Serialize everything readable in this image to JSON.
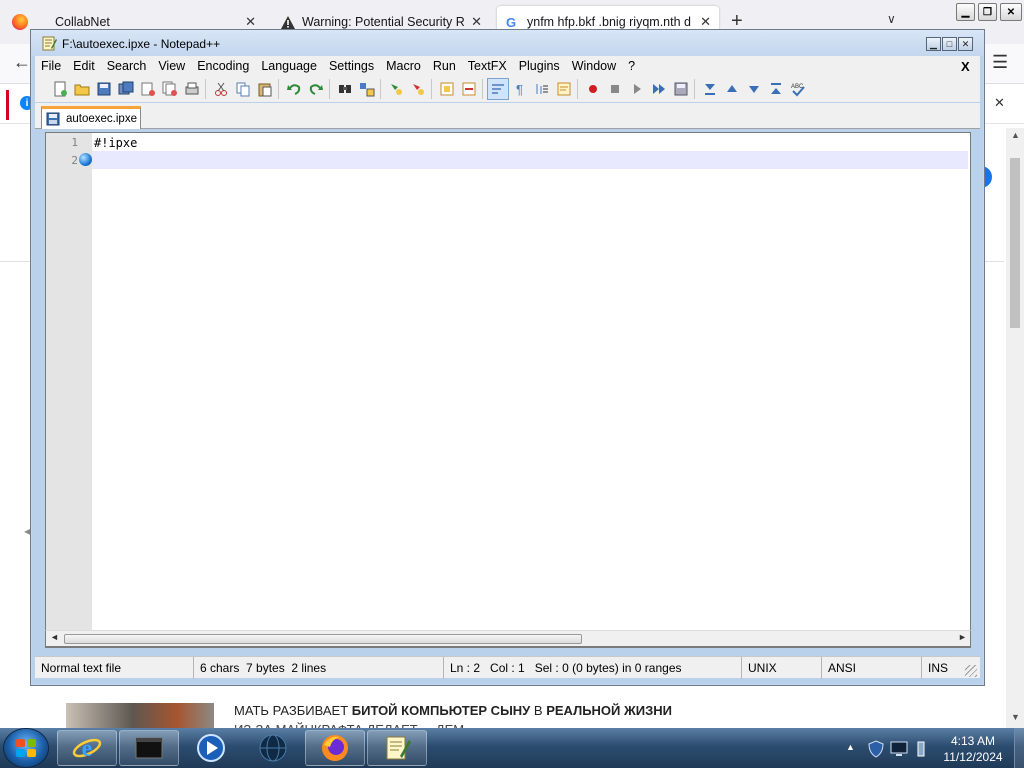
{
  "browser": {
    "tabs": [
      {
        "label": "CollabNet",
        "icon": "firefox-icon"
      },
      {
        "label": "Warning: Potential Security Risk",
        "icon": "warning-icon"
      },
      {
        "label": "ynfm hfp.bkf .bnig riyqm.nth d",
        "icon": "google-icon"
      }
    ],
    "new_tab": "+",
    "list_tabs": "∨",
    "window_controls": [
      "minimize",
      "restore",
      "close"
    ],
    "page": {
      "headline_plain_1": "МАТЬ РАЗБИВАЕТ ",
      "headline_bold_1": "БИТОЙ КОМПЬЮТЕР СЫНУ",
      "headline_plain_2": " В ",
      "headline_bold_2": "РЕАЛЬНОЙ ЖИЗНИ",
      "subline": "ИЗ-ЗА МАЙНКРАФТА ДЕЛАЕТ ... ДЕМ"
    }
  },
  "notepad": {
    "title": "F:\\autoexec.ipxe - Notepad++",
    "menu": [
      "File",
      "Edit",
      "Search",
      "View",
      "Encoding",
      "Language",
      "Settings",
      "Macro",
      "Run",
      "TextFX",
      "Plugins",
      "Window",
      "?"
    ],
    "menu_close": "X",
    "toolbar": [
      "new-file-icon",
      "open-file-icon",
      "save-icon",
      "save-all-icon",
      "close-icon",
      "close-all-icon",
      "print-icon",
      "|",
      "cut-icon",
      "copy-icon",
      "paste-icon",
      "|",
      "undo-icon",
      "redo-icon",
      "|",
      "find-icon",
      "replace-icon",
      "|",
      "zoom-in-icon",
      "zoom-out-icon",
      "|",
      "sync-vertical-icon",
      "sync-horizontal-icon",
      "|",
      "word-wrap-icon",
      "show-all-chars-icon",
      "indent-guide-icon",
      "user-lang-icon",
      "|",
      "record-macro-icon",
      "stop-record-icon",
      "play-macro-icon",
      "run-multiple-icon",
      "save-macro-icon",
      "|",
      "fold-all-icon",
      "prev-bookmark-icon",
      "next-bookmark-icon",
      "unfold-all-icon",
      "spell-check-icon"
    ],
    "file_tab": "autoexec.ipxe",
    "lines": [
      "#!ipxe",
      ""
    ],
    "line_numbers": [
      "1",
      "2"
    ],
    "status": {
      "type": "Normal text file",
      "chars": "6 chars",
      "bytes": "7 bytes",
      "lines": "2 lines",
      "ln": "Ln : 2",
      "col": "Col : 1",
      "sel": "Sel : 0 (0 bytes) in 0 ranges",
      "eol": "UNIX",
      "encoding": "ANSI",
      "mode": "INS"
    }
  },
  "taskbar": {
    "apps": [
      "internet-explorer-icon",
      "cmd-icon",
      "media-player-icon",
      "network-globe-icon",
      "firefox-icon",
      "notepad-plus-plus-icon"
    ],
    "tray_icons": [
      "tray-arrow-icon",
      "shield-icon",
      "monitor-icon",
      "network-icon"
    ],
    "time": "4:13 AM",
    "date": "11/12/2024"
  }
}
